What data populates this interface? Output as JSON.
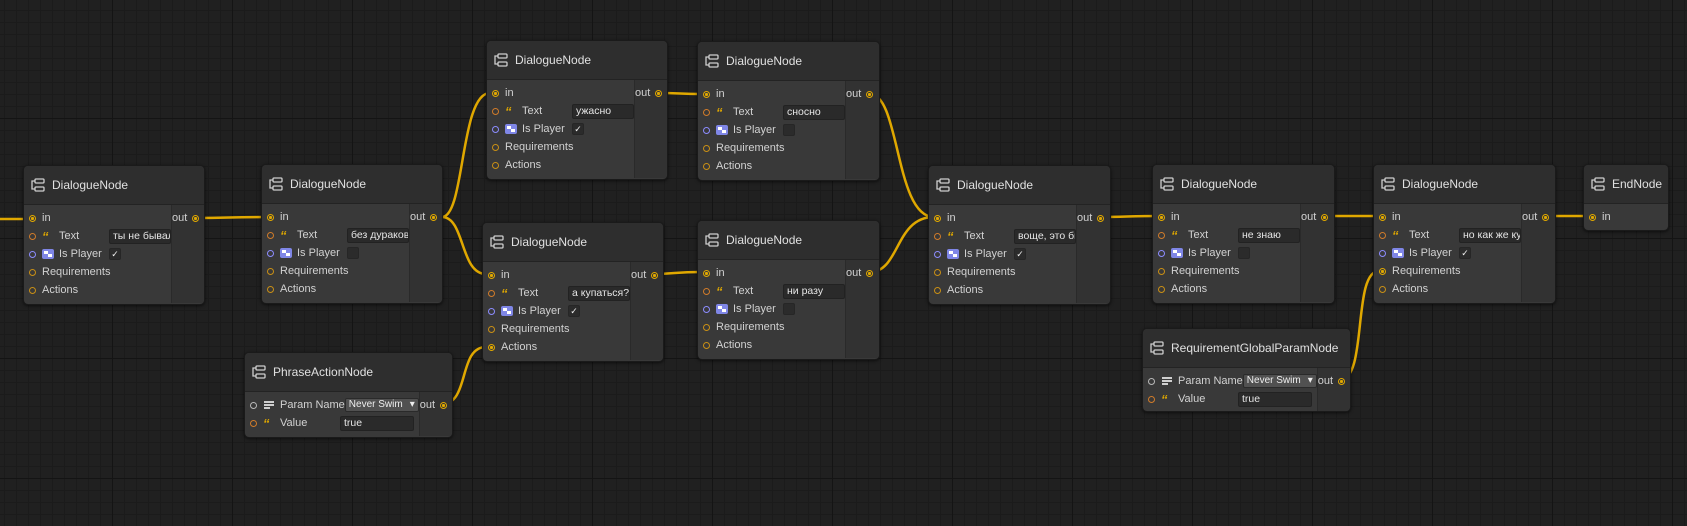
{
  "colors": {
    "background": "#202020",
    "node": "#393939",
    "edge": "#e0a800",
    "string_port": "#d07b2a",
    "bool_port": "#8c8cff"
  },
  "icons": {
    "node": "node-graph-icon",
    "text": "quote-icon",
    "bool": "toggle-icon",
    "param": "list-icon"
  },
  "labels": {
    "in": "in",
    "out": "out",
    "text": "Text",
    "is_player": "Is Player",
    "requirements": "Requirements",
    "actions": "Actions",
    "param_name": "Param Name",
    "value": "Value"
  },
  "nodes": [
    {
      "title": "DialogueNode",
      "text": "ты не бывал",
      "is_player": true
    },
    {
      "title": "DialogueNode",
      "text": "без дураков",
      "is_player": false
    },
    {
      "title": "DialogueNode",
      "text": "ужасно",
      "is_player": true
    },
    {
      "title": "DialogueNode",
      "text": "сносно",
      "is_player": false
    },
    {
      "title": "DialogueNode",
      "text": "а купаться?",
      "is_player": true
    },
    {
      "title": "DialogueNode",
      "text": "ни разу",
      "is_player": false
    },
    {
      "title": "DialogueNode",
      "text": "воще, это бь",
      "is_player": true
    },
    {
      "title": "DialogueNode",
      "text": "не знаю",
      "is_player": false
    },
    {
      "title": "DialogueNode",
      "text": "но как же ку",
      "is_player": true
    },
    {
      "title": "EndNode"
    },
    {
      "title": "PhraseActionNode",
      "param_name": "Never Swim",
      "value": "true"
    },
    {
      "title": "RequirementGlobalParamNode",
      "param_name": "Never Swim",
      "value": "true"
    }
  ]
}
